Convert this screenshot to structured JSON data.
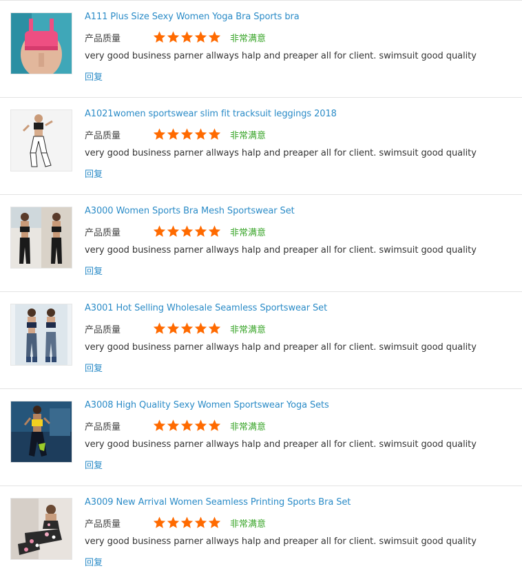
{
  "colors": {
    "link": "#2a8bc7",
    "star": "#ff6a00",
    "rating_text": "#3aa52a",
    "divider": "#e3e3e3"
  },
  "reviews": [
    {
      "title": "A111 Plus Size Sexy Women Yoga Bra Sports bra",
      "rating_label": "产品质量",
      "stars": 5,
      "rating_text": "非常满意",
      "comment": "very good business parner allways halp and preaper all for client. swimsuit good quality",
      "reply_label": "回复",
      "thumb_icon": "pink-sports-bra-photo"
    },
    {
      "title": "A1021women sportswear slim fit tracksuit leggings 2018",
      "rating_label": "产品质量",
      "stars": 5,
      "rating_text": "非常满意",
      "comment": "very good business parner allways halp and preaper all for client. swimsuit good quality",
      "reply_label": "回复",
      "thumb_icon": "white-leggings-photo"
    },
    {
      "title": "A3000 Women Sports Bra Mesh Sportswear Set",
      "rating_label": "产品质量",
      "stars": 5,
      "rating_text": "非常满意",
      "comment": "very good business parner allways halp and preaper all for client. swimsuit good quality",
      "reply_label": "回复",
      "thumb_icon": "black-mesh-set-photo"
    },
    {
      "title": "A3001 Hot Selling Wholesale Seamless Sportswear Set",
      "rating_label": "产品质量",
      "stars": 5,
      "rating_text": "非常满意",
      "comment": "very good business parner allways halp and preaper all for client. swimsuit good quality",
      "reply_label": "回复",
      "thumb_icon": "seamless-set-photo"
    },
    {
      "title": "A3008 High Quality Sexy Women Sportswear Yoga Sets",
      "rating_label": "产品质量",
      "stars": 5,
      "rating_text": "非常满意",
      "comment": "very good business parner allways halp and preaper all for client. swimsuit good quality",
      "reply_label": "回复",
      "thumb_icon": "yellow-yoga-set-photo"
    },
    {
      "title": "A3009 New Arrival Women Seamless Printing Sports Bra Set",
      "rating_label": "产品质量",
      "stars": 5,
      "rating_text": "非常满意",
      "comment": "very good business parner allways halp and preaper all for client. swimsuit good quality",
      "reply_label": "回复",
      "thumb_icon": "floral-print-set-photo"
    }
  ]
}
